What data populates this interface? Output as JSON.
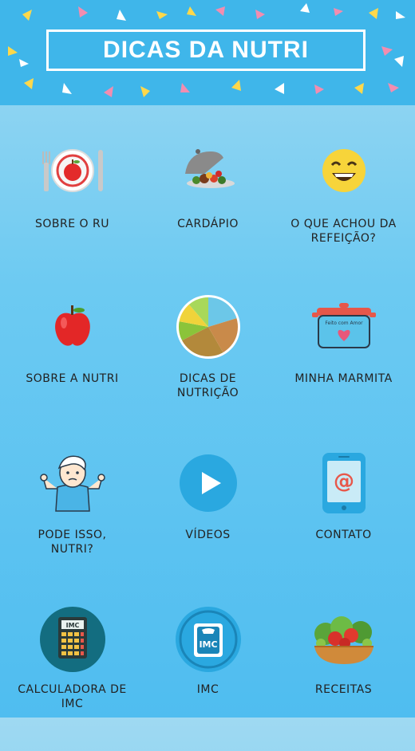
{
  "header": {
    "title": "DICAS DA NUTRI"
  },
  "menu": {
    "items": [
      {
        "label": "SOBRE O RU",
        "icon": "plate-apple-icon"
      },
      {
        "label": "CARDÁPIO",
        "icon": "serving-dish-icon"
      },
      {
        "label": "O QUE ACHOU DA\nREFEIÇÃO?",
        "icon": "smiley-face-icon"
      },
      {
        "label": "SOBRE A NUTRI",
        "icon": "apple-icon"
      },
      {
        "label": "DICAS DE\nNUTRIÇÃO",
        "icon": "food-wheel-icon"
      },
      {
        "label": "MINHA MARMITA",
        "icon": "lunch-pot-icon"
      },
      {
        "label": "PODE ISSO,\nNUTRI?",
        "icon": "shrugging-nutritionist-icon"
      },
      {
        "label": "VÍDEOS",
        "icon": "play-icon"
      },
      {
        "label": "CONTATO",
        "icon": "phone-email-icon"
      },
      {
        "label": "CALCULADORA DE\nIMC",
        "icon": "calculator-icon"
      },
      {
        "label": "IMC",
        "icon": "scale-icon"
      },
      {
        "label": "RECEITAS",
        "icon": "salad-bowl-icon"
      }
    ],
    "pot_text": "Feito com Amor",
    "calculator_text": "IMC",
    "scale_text": "IMC"
  },
  "colors": {
    "header_bg": "#3fb6ea",
    "page_bg": "#6ccaf2",
    "accent_blue": "#1fa6de"
  }
}
